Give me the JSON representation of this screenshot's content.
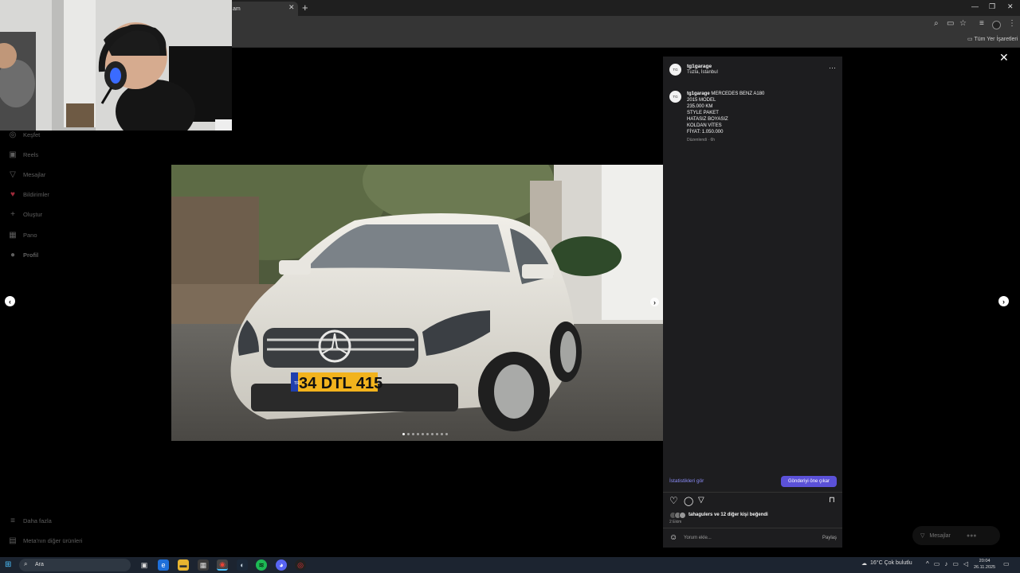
{
  "browser": {
    "tab_title": "am",
    "tab_close": "✕",
    "new_tab": "+",
    "bookmarks_all": "Tüm Yer İşaretleri",
    "window_minimize": "—",
    "window_restore": "❐",
    "window_close": "✕"
  },
  "sidebar": {
    "items": [
      {
        "label": "Keşfet",
        "icon": "compass-icon",
        "glyph": "◎"
      },
      {
        "label": "Reels",
        "icon": "reels-icon",
        "glyph": "▣"
      },
      {
        "label": "Mesajlar",
        "icon": "send-icon",
        "glyph": "▽"
      },
      {
        "label": "Bildirimler",
        "icon": "heart-icon",
        "glyph": "♥"
      },
      {
        "label": "Oluştur",
        "icon": "plus-icon",
        "glyph": "+"
      },
      {
        "label": "Pano",
        "icon": "dashboard-icon",
        "glyph": "▦"
      },
      {
        "label": "Profil",
        "icon": "avatar-icon",
        "glyph": "●"
      }
    ],
    "more": "Daha fazla",
    "meta": "Meta'nın diğer ürünleri"
  },
  "post": {
    "username": "tg1garage",
    "location": "Tuzla, İstanbul",
    "avatar_text": "TG",
    "more_glyph": "···",
    "caption_user": "tg1garage",
    "caption_lines": [
      "MERCEDES BENZ A180",
      "2015 MODEL",
      "235.000 KM",
      "STYLE PAKET",
      "HATASIZ BOYASIZ",
      "KOLDAN VİTES",
      "FİYAT: 1.050.000"
    ],
    "edited": "Düzenlendi · 6h",
    "insights": "İstatistikleri gör",
    "boost": "Gönderiyi öne çıkar",
    "likes": "tahagulers ve 12 diğer kişi beğendi",
    "date": "2 Ekim",
    "comment_placeholder": "Yorum ekle...",
    "share": "Paylaş",
    "plate": "34 DTL 415",
    "plate_country": "TR",
    "carousel_count": 10,
    "carousel_active": 0
  },
  "messages_pill": "Mesajlar",
  "taskbar": {
    "search": "Ara",
    "weather": "16°C  Çok bulutlu",
    "time": "20:04",
    "date": "26.11.2025"
  },
  "colors": {
    "accent": "#5b51d8",
    "link": "#8b8cf8",
    "panel": "#1d1d1f"
  }
}
